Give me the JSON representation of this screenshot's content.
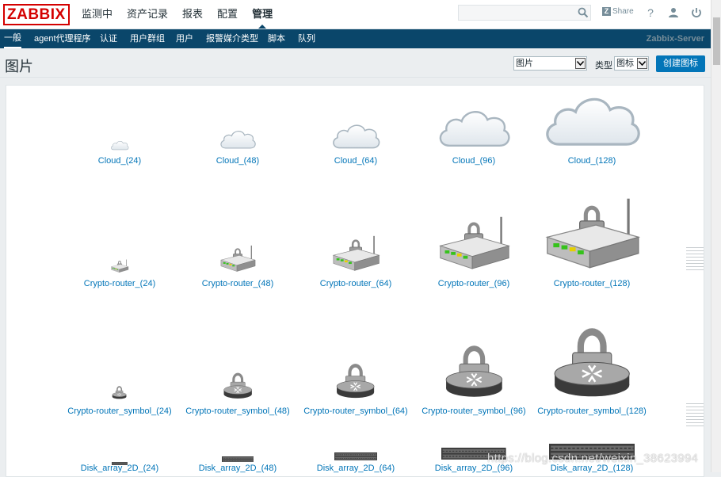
{
  "app": {
    "logo": "ZABBIX",
    "main_menu": [
      "监测中",
      "资产记录",
      "报表",
      "配置",
      "管理"
    ],
    "main_menu_active": "管理",
    "search": {
      "value": "",
      "placeholder": ""
    },
    "share_label": "Share",
    "help_icon": "?",
    "user_icon": "user-icon",
    "power_icon": "power-icon"
  },
  "sub_menu": {
    "items": [
      "一般",
      "agent代理程序",
      "认证",
      "用户群组",
      "用户",
      "报警媒介类型",
      "脚本",
      "队列"
    ],
    "active": "一般",
    "server_name": "Zabbix-Server"
  },
  "page": {
    "title": "图片",
    "general_select": "图片",
    "type_label": "类型",
    "type_select": "图标",
    "create_button": "创建图标"
  },
  "images": [
    {
      "name": "Cloud_(24)",
      "kind": "cloud",
      "size": 24
    },
    {
      "name": "Cloud_(48)",
      "kind": "cloud",
      "size": 48
    },
    {
      "name": "Cloud_(64)",
      "kind": "cloud",
      "size": 64
    },
    {
      "name": "Cloud_(96)",
      "kind": "cloud",
      "size": 96
    },
    {
      "name": "Cloud_(128)",
      "kind": "cloud",
      "size": 128
    },
    {
      "name": "Crypto-router_(24)",
      "kind": "router",
      "size": 24
    },
    {
      "name": "Crypto-router_(48)",
      "kind": "router",
      "size": 48
    },
    {
      "name": "Crypto-router_(64)",
      "kind": "router",
      "size": 64
    },
    {
      "name": "Crypto-router_(96)",
      "kind": "router",
      "size": 96
    },
    {
      "name": "Crypto-router_(128)",
      "kind": "router",
      "size": 128
    },
    {
      "name": "Crypto-router_symbol_(24)",
      "kind": "symbol",
      "size": 24
    },
    {
      "name": "Crypto-router_symbol_(48)",
      "kind": "symbol",
      "size": 48
    },
    {
      "name": "Crypto-router_symbol_(64)",
      "kind": "symbol",
      "size": 64
    },
    {
      "name": "Crypto-router_symbol_(96)",
      "kind": "symbol",
      "size": 96
    },
    {
      "name": "Crypto-router_symbol_(128)",
      "kind": "symbol",
      "size": 128
    },
    {
      "name": "Disk_array_2D_(24)",
      "kind": "disk",
      "size": 24
    },
    {
      "name": "Disk_array_2D_(48)",
      "kind": "disk",
      "size": 48
    },
    {
      "name": "Disk_array_2D_(64)",
      "kind": "disk",
      "size": 64
    },
    {
      "name": "Disk_array_2D_(96)",
      "kind": "disk",
      "size": 96
    },
    {
      "name": "Disk_array_2D_(128)",
      "kind": "disk",
      "size": 128
    }
  ],
  "watermark": "https://blog.csdn.net/weixin_38623994",
  "colors": {
    "brand_red": "#d40000",
    "nav_dark": "#0a466a",
    "link_blue": "#0275b8",
    "button_blue": "#0275b8"
  }
}
